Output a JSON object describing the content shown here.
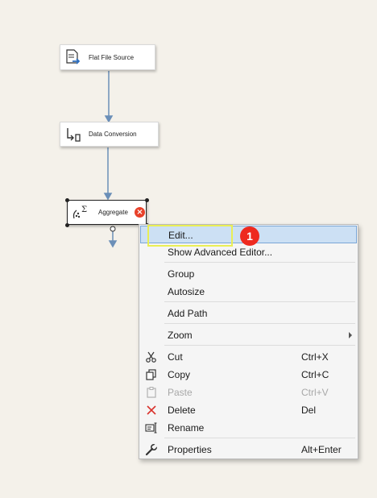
{
  "canvas": {
    "nodes": {
      "flat_file_source": {
        "label": "Flat File Source",
        "icon": "flat-file-source-icon"
      },
      "data_conversion": {
        "label": "Data Conversion",
        "icon": "data-conversion-icon"
      },
      "aggregate": {
        "label": "Aggregate",
        "icon": "aggregate-icon",
        "status": "error"
      }
    }
  },
  "context_menu": {
    "items": [
      {
        "label": "Edit...",
        "highlighted": true
      },
      {
        "label": "Show Advanced Editor..."
      },
      {
        "label": "Group"
      },
      {
        "label": "Autosize"
      },
      {
        "label": "Add Path"
      },
      {
        "label": "Zoom",
        "submenu": true
      },
      {
        "label": "Cut",
        "shortcut": "Ctrl+X",
        "icon": "cut-icon"
      },
      {
        "label": "Copy",
        "shortcut": "Ctrl+C",
        "icon": "copy-icon"
      },
      {
        "label": "Paste",
        "shortcut": "Ctrl+V",
        "icon": "paste-icon",
        "disabled": true
      },
      {
        "label": "Delete",
        "shortcut": "Del",
        "icon": "delete-icon"
      },
      {
        "label": "Rename",
        "icon": "rename-icon"
      },
      {
        "label": "Properties",
        "shortcut": "Alt+Enter",
        "icon": "wrench-icon"
      }
    ]
  },
  "annotation": {
    "step_number": "1"
  },
  "colors": {
    "highlight": "#cce0f4",
    "callout_box": "#e9ee55",
    "badge": "#ee2a1f",
    "error": "#e8412a",
    "connector": "#6b8fb8"
  }
}
